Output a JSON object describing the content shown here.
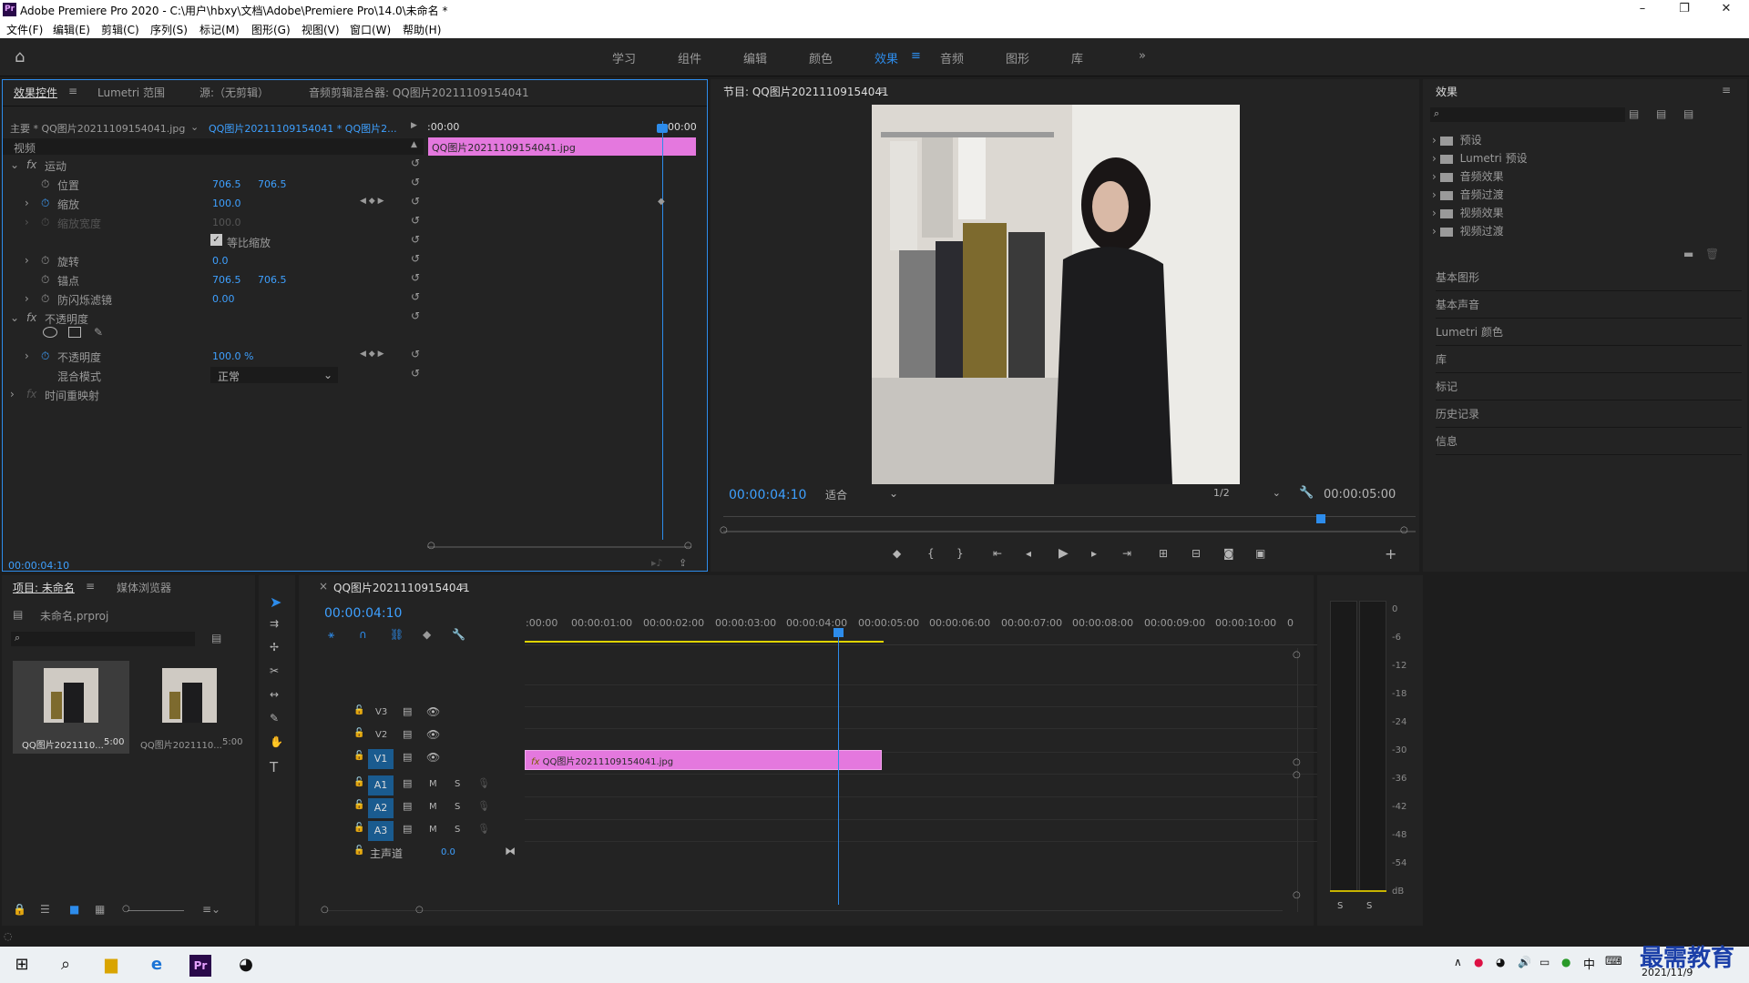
{
  "window": {
    "title": "Adobe Premiere Pro 2020 - C:\\用户\\hbxy\\文档\\Adobe\\Premiere Pro\\14.0\\未命名 *",
    "logo": "Pr"
  },
  "menu": [
    "文件(F)",
    "编辑(E)",
    "剪辑(C)",
    "序列(S)",
    "标记(M)",
    "图形(G)",
    "视图(V)",
    "窗口(W)",
    "帮助(H)"
  ],
  "workspaces": [
    "学习",
    "组件",
    "编辑",
    "颜色",
    "效果",
    "音频",
    "图形",
    "库"
  ],
  "active_workspace": "效果",
  "effect_controls": {
    "tabs": [
      "效果控件",
      "Lumetri 范围",
      "源:（无剪辑）",
      "音频剪辑混合器: QQ图片20211109154041"
    ],
    "master": "主要 * QQ图片20211109154041.jpg",
    "clip": "QQ图片20211109154041 * QQ图片2...",
    "time_start": ":00:00",
    "time_end": "00:00",
    "clip_bar": "QQ图片20211109154041.jpg",
    "section_video": "视频",
    "motion": "运动",
    "position_label": "位置",
    "position_x": "706.5",
    "position_y": "706.5",
    "scale_label": "缩放",
    "scale_value": "100.0",
    "scale_width_label": "缩放宽度",
    "scale_width_value": "100.0",
    "uniform_label": "等比缩放",
    "rotation_label": "旋转",
    "rotation_value": "0.0",
    "anchor_label": "锚点",
    "anchor_x": "706.5",
    "anchor_y": "706.5",
    "flicker_label": "防闪烁滤镜",
    "flicker_value": "0.00",
    "opacity_section": "不透明度",
    "opacity_label": "不透明度",
    "opacity_value": "100.0 %",
    "blend_label": "混合模式",
    "blend_value": "正常",
    "time_remap": "时间重映射",
    "footer_time": "00:00:04:10"
  },
  "program": {
    "title": "节目: QQ图片20211109154041",
    "timecode": "00:00:04:10",
    "fit": "适合",
    "quality": "1/2",
    "duration": "00:00:05:00"
  },
  "effects_panel": {
    "title": "效果",
    "tree": [
      "预设",
      "Lumetri 预设",
      "音频效果",
      "音频过渡",
      "视频效果",
      "视频过渡"
    ],
    "sections": [
      "基本图形",
      "基本声音",
      "Lumetri 颜色",
      "库",
      "标记",
      "历史记录",
      "信息"
    ]
  },
  "project": {
    "tabs": [
      "项目: 未命名",
      "媒体浏览器"
    ],
    "file": "未命名.prproj",
    "items": [
      {
        "name": "QQ图片2021110...",
        "dur": "5:00"
      },
      {
        "name": "QQ图片2021110...",
        "dur": "5:00"
      }
    ]
  },
  "timeline": {
    "title": "QQ图片20211109154041",
    "timecode": "00:00:04:10",
    "ruler": [
      ":00:00",
      "00:00:01:00",
      "00:00:02:00",
      "00:00:03:00",
      "00:00:04:00",
      "00:00:05:00",
      "00:00:06:00",
      "00:00:07:00",
      "00:00:08:00",
      "00:00:09:00",
      "00:00:10:00",
      "0"
    ],
    "video_tracks": [
      "V3",
      "V2",
      "V1"
    ],
    "audio_tracks": [
      "A1",
      "A2",
      "A3"
    ],
    "master_label": "主声道",
    "master_value": "0.0",
    "clip": "QQ图片20211109154041.jpg",
    "m": "M",
    "s": "S"
  },
  "meter": {
    "labels": [
      "0",
      "-6",
      "-12",
      "-18",
      "-24",
      "-30",
      "-36",
      "-42",
      "-48",
      "-54",
      "dB"
    ],
    "s1": "S",
    "s2": "S"
  },
  "taskbar": {
    "ime": "中",
    "date": "2021/11/9",
    "watermark": "最需教育"
  }
}
